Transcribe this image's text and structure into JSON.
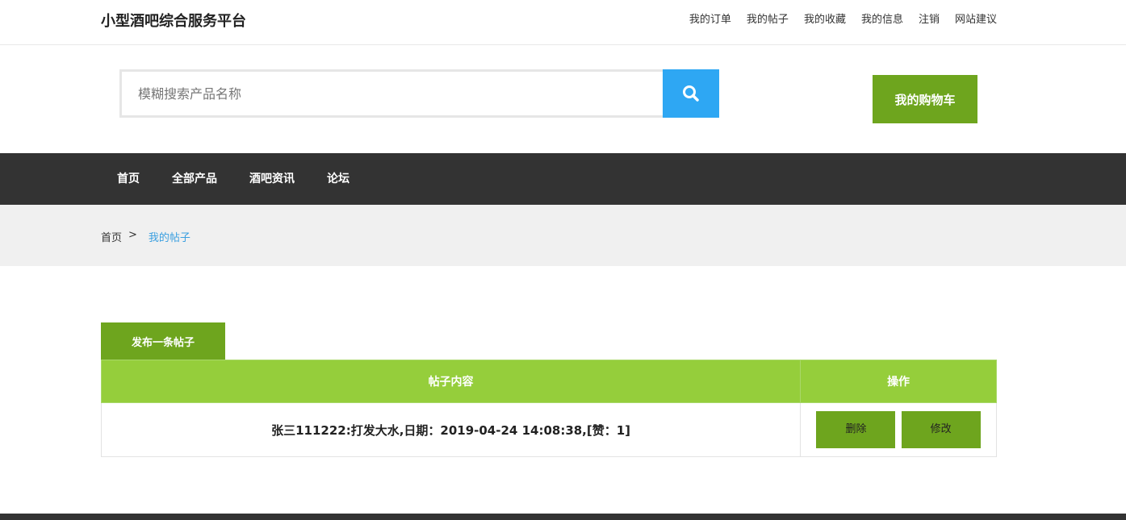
{
  "header": {
    "logo": "小型酒吧综合服务平台",
    "links": [
      "我的订单",
      "我的帖子",
      "我的收藏",
      "我的信息",
      "注销",
      "网站建议"
    ]
  },
  "search": {
    "placeholder": "模糊搜索产品名称",
    "button_icon": "search-icon"
  },
  "cart": {
    "label": "我的购物车"
  },
  "nav": {
    "items": [
      "首页",
      "全部产品",
      "酒吧资讯",
      "论坛"
    ]
  },
  "breadcrumb": {
    "home": "首页",
    "separator": ">",
    "current": "我的帖子"
  },
  "posts": {
    "publish_label": "发布一条帖子",
    "columns": [
      "帖子内容",
      "操作"
    ],
    "rows": [
      {
        "content": "张三111222:打发大水,日期：2019-04-24 14:08:38,[赞：1]",
        "actions": [
          "删除",
          "修改"
        ]
      }
    ]
  },
  "colors": {
    "accent_green": "#6ea51e",
    "header_green": "#95ce3b",
    "search_blue": "#2ea7f3",
    "nav_dark": "#333333",
    "link_blue": "#3a9fe0"
  }
}
